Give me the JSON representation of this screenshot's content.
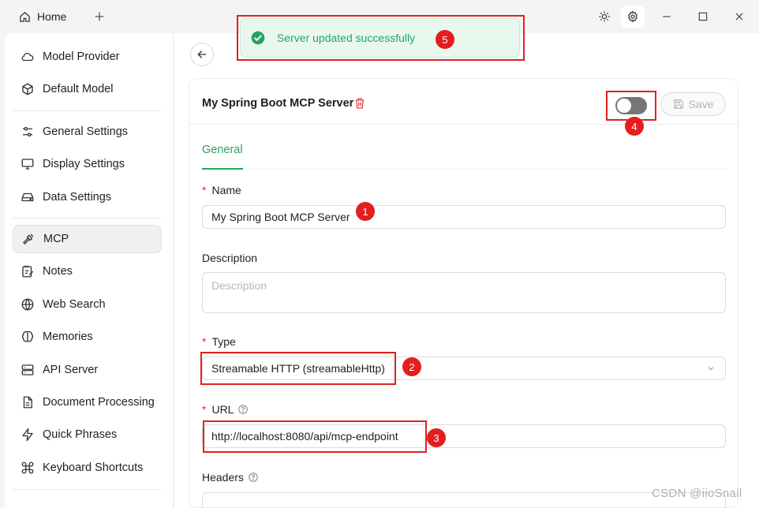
{
  "titlebar": {
    "home_tab": "Home",
    "theme_icon": "sun-icon",
    "settings_icon": "gear-icon"
  },
  "sidebar": {
    "items": [
      {
        "label": "Model Provider",
        "icon": "cloud-icon"
      },
      {
        "label": "Default Model",
        "icon": "cube-icon"
      },
      {
        "label": "General Settings",
        "icon": "sliders-icon"
      },
      {
        "label": "Display Settings",
        "icon": "monitor-icon"
      },
      {
        "label": "Data Settings",
        "icon": "drive-icon"
      },
      {
        "label": "MCP",
        "icon": "hammer-icon",
        "active": true
      },
      {
        "label": "Notes",
        "icon": "notes-icon"
      },
      {
        "label": "Web Search",
        "icon": "globe-icon"
      },
      {
        "label": "Memories",
        "icon": "brain-icon"
      },
      {
        "label": "API Server",
        "icon": "server-icon"
      },
      {
        "label": "Document Processing",
        "icon": "document-icon"
      },
      {
        "label": "Quick Phrases",
        "icon": "zap-icon"
      },
      {
        "label": "Keyboard Shortcuts",
        "icon": "command-icon"
      }
    ]
  },
  "server": {
    "title": "My Spring Boot MCP Server",
    "enabled": false,
    "save_label": "Save",
    "tab_general": "General",
    "name_label": "Name",
    "name_value": "My Spring Boot MCP Server",
    "description_label": "Description",
    "description_placeholder": "Description",
    "type_label": "Type",
    "type_value": "Streamable HTTP (streamableHttp)",
    "url_label": "URL",
    "url_value": "http://localhost:8080/api/mcp-endpoint",
    "headers_label": "Headers",
    "required_mark": "*"
  },
  "toast": {
    "message": "Server updated successfully"
  },
  "annotations": [
    "1",
    "2",
    "3",
    "4",
    "5"
  ],
  "watermark": "CSDN @iioSnail",
  "colors": {
    "accent": "#27a35f",
    "highlight": "#e02020",
    "badge": "#e41e1e",
    "toast_bg": "#e9f8ef"
  }
}
